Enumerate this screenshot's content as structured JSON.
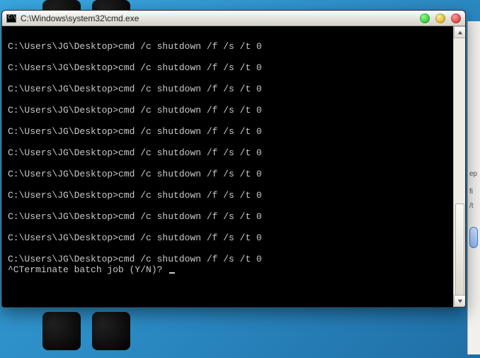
{
  "window": {
    "title": "C:\\Windows\\system32\\cmd.exe"
  },
  "controls": {
    "minimize": "minimize",
    "maximize": "maximize",
    "close": "close"
  },
  "cmd": {
    "prompt": "C:\\Users\\JG\\Desktop>",
    "command": "cmd /c shutdown /f /s /t 0",
    "repeat_count": 11,
    "interrupt_line": "^CTerminate batch job (Y/N)?"
  },
  "right_fragments": {
    "a": "ep",
    "b": "fi",
    "c": "/t"
  }
}
